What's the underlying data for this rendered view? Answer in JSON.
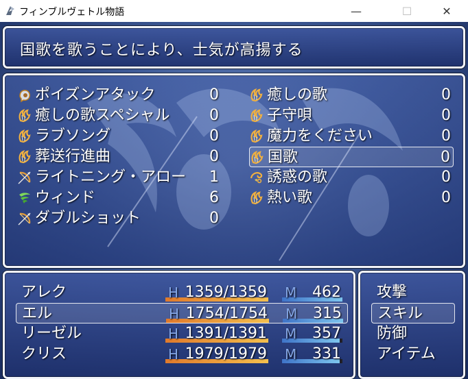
{
  "window": {
    "title": "フィンブルヴェトル物語",
    "minimize": "—",
    "maximize": "☐",
    "close": "✕"
  },
  "help": {
    "text": "国歌を歌うことにより、士気が高揚する"
  },
  "skills": [
    {
      "icon": "fist-icon",
      "name": "ポイズンアタック",
      "cost": "0"
    },
    {
      "icon": "harp-icon",
      "name": "癒しの歌",
      "cost": "0"
    },
    {
      "icon": "harp-icon",
      "name": "癒しの歌スペシャル",
      "cost": "0"
    },
    {
      "icon": "harp-icon",
      "name": "子守唄",
      "cost": "0"
    },
    {
      "icon": "harp-icon",
      "name": "ラブソング",
      "cost": "0"
    },
    {
      "icon": "harp-icon",
      "name": "魔力をください",
      "cost": "0"
    },
    {
      "icon": "harp-icon",
      "name": "葬送行進曲",
      "cost": "0"
    },
    {
      "icon": "harp-icon",
      "name": "国歌",
      "cost": "0",
      "selected": true
    },
    {
      "icon": "bow-icon",
      "name": "ライトニング・アロー",
      "cost": "1"
    },
    {
      "icon": "charm-icon",
      "name": "誘惑の歌",
      "cost": "0"
    },
    {
      "icon": "wind-icon",
      "name": "ウィンド",
      "cost": "6"
    },
    {
      "icon": "harp-icon",
      "name": "熱い歌",
      "cost": "0"
    },
    {
      "icon": "bow-icon",
      "name": "ダブルショット",
      "cost": "0"
    }
  ],
  "party": [
    {
      "name": "アレク",
      "hp_label": "H",
      "hp": "1359/1359",
      "hp_ratio": 1.0,
      "mp_label": "M",
      "mp": "462",
      "mp_ratio": 1.0
    },
    {
      "name": "エル",
      "hp_label": "H",
      "hp": "1754/1754",
      "hp_ratio": 1.0,
      "mp_label": "M",
      "mp": "315",
      "mp_ratio": 1.0,
      "selected": true
    },
    {
      "name": "リーゼル",
      "hp_label": "H",
      "hp": "1391/1391",
      "hp_ratio": 1.0,
      "mp_label": "M",
      "mp": "357",
      "mp_ratio": 0.95
    },
    {
      "name": "クリス",
      "hp_label": "H",
      "hp": "1979/1979",
      "hp_ratio": 1.0,
      "mp_label": "M",
      "mp": "331",
      "mp_ratio": 0.96
    }
  ],
  "commands": [
    {
      "label": "攻撃"
    },
    {
      "label": "スキル",
      "selected": true
    },
    {
      "label": "防御"
    },
    {
      "label": "アイテム"
    }
  ],
  "colors": {
    "hp_gauge_start": "#e07a2c",
    "hp_gauge_end": "#f4c04e",
    "mp_gauge_start": "#3f74c8",
    "mp_gauge_end": "#7ec6ef",
    "gauge_back": "#202028",
    "label_color": "#84a6e6"
  }
}
